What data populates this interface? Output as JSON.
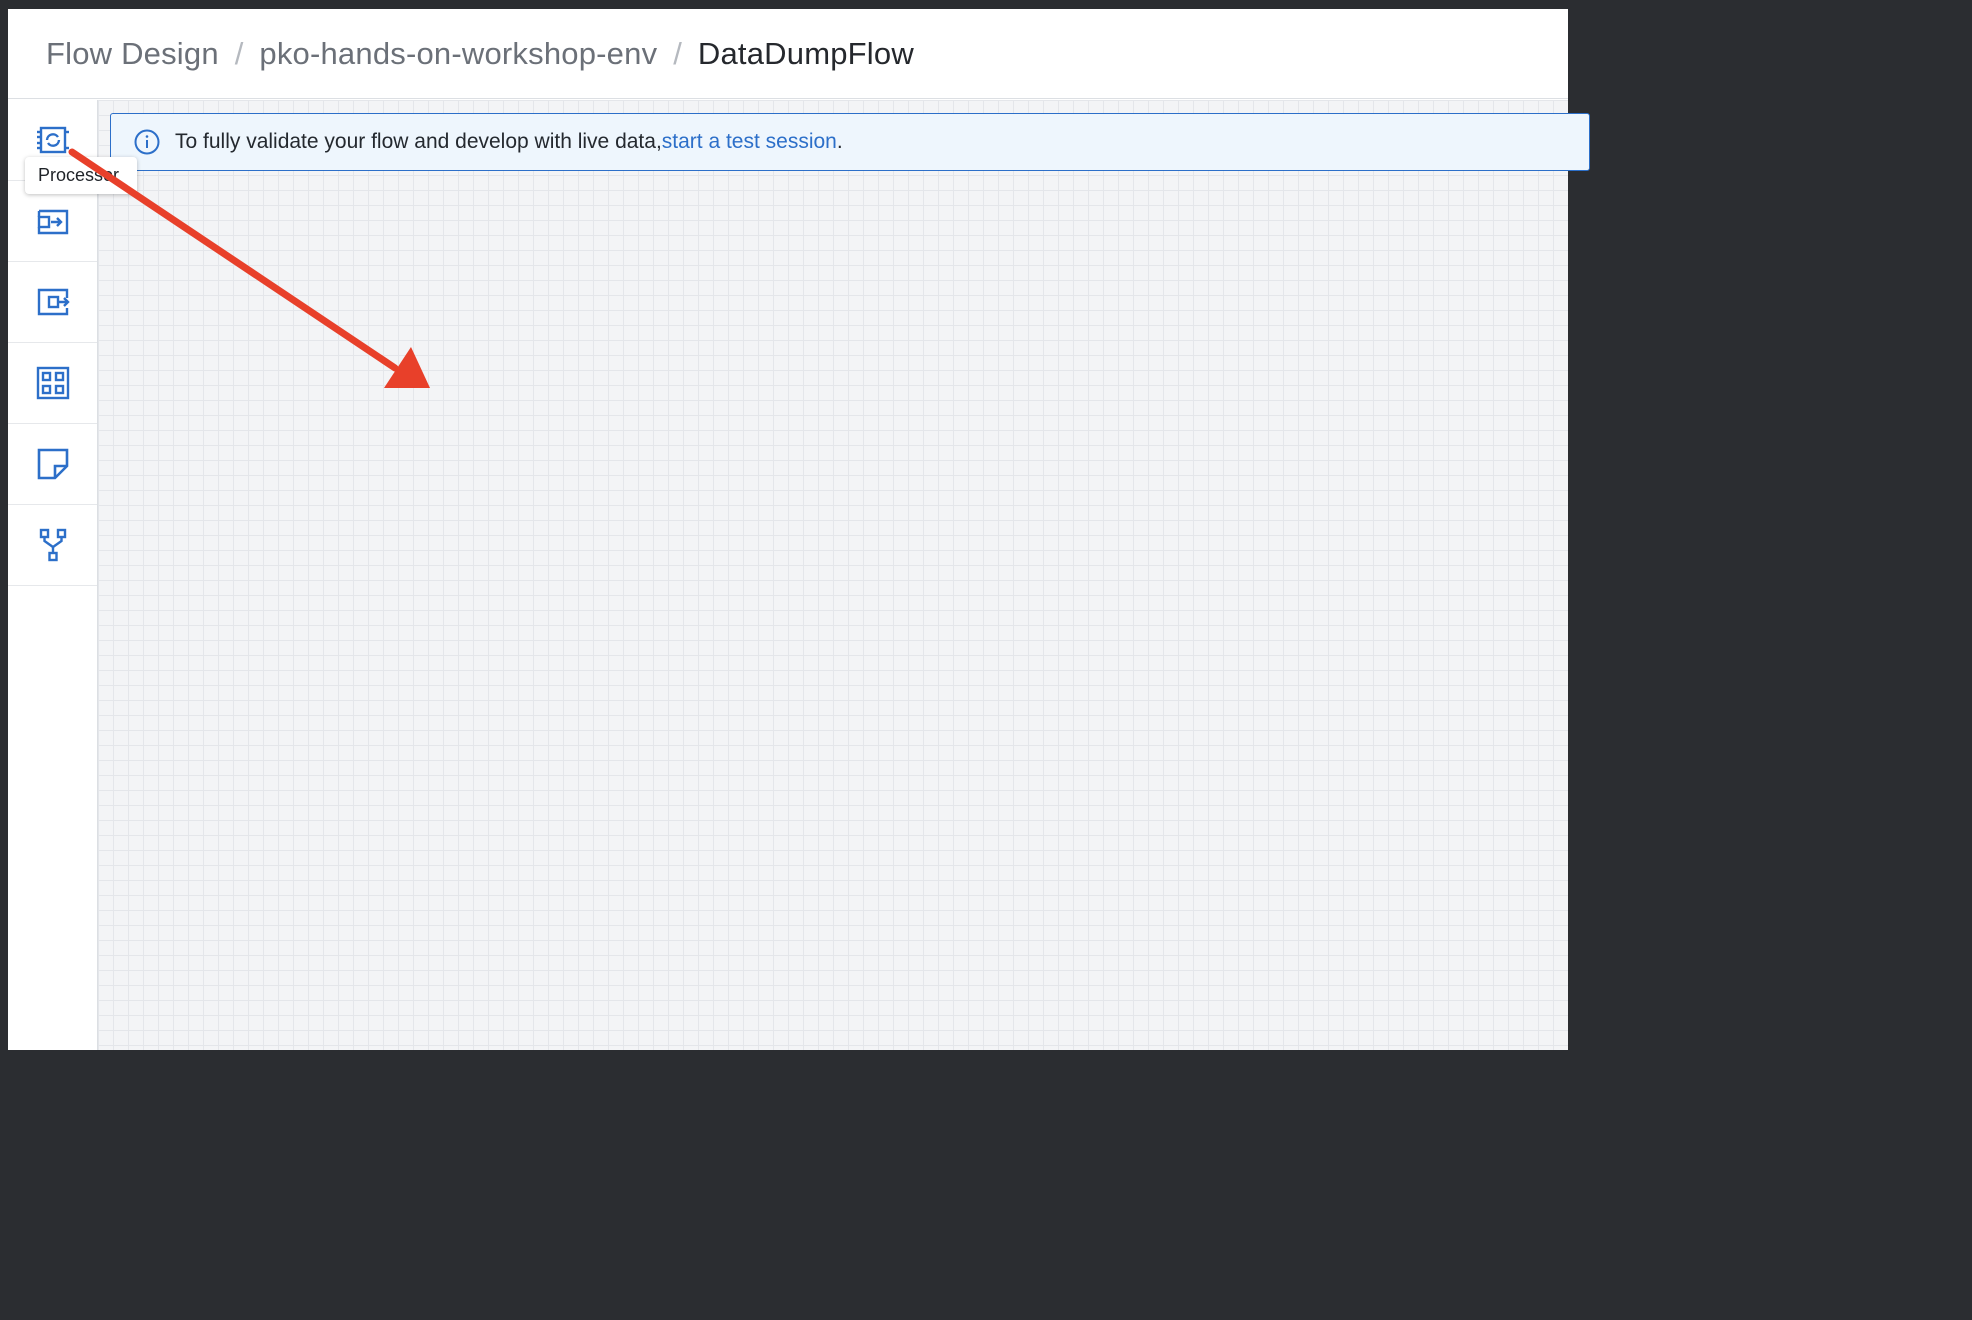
{
  "breadcrumb": {
    "items": [
      {
        "label": "Flow Design"
      },
      {
        "label": "pko-hands-on-workshop-env"
      },
      {
        "label": "DataDumpFlow"
      }
    ],
    "separator": "/"
  },
  "sidebar": {
    "tools": [
      {
        "icon": "processor-icon",
        "name": "processor"
      },
      {
        "icon": "input-port-icon",
        "name": "input-port"
      },
      {
        "icon": "output-port-icon",
        "name": "output-port"
      },
      {
        "icon": "process-group-icon",
        "name": "process-group"
      },
      {
        "icon": "label-note-icon",
        "name": "label"
      },
      {
        "icon": "funnel-icon",
        "name": "funnel"
      }
    ],
    "tooltip": "Processor"
  },
  "banner": {
    "text": "To fully validate your flow and develop with live data, ",
    "link": "start a test session",
    "suffix": ".",
    "icon": "info-icon"
  },
  "annotation": {
    "icon": "red-arrow-annotation",
    "color": "#e8402a"
  },
  "colors": {
    "accent": "#2c6fc9",
    "banner_bg": "#eef6fd",
    "canvas_bg": "#f3f4f6"
  }
}
